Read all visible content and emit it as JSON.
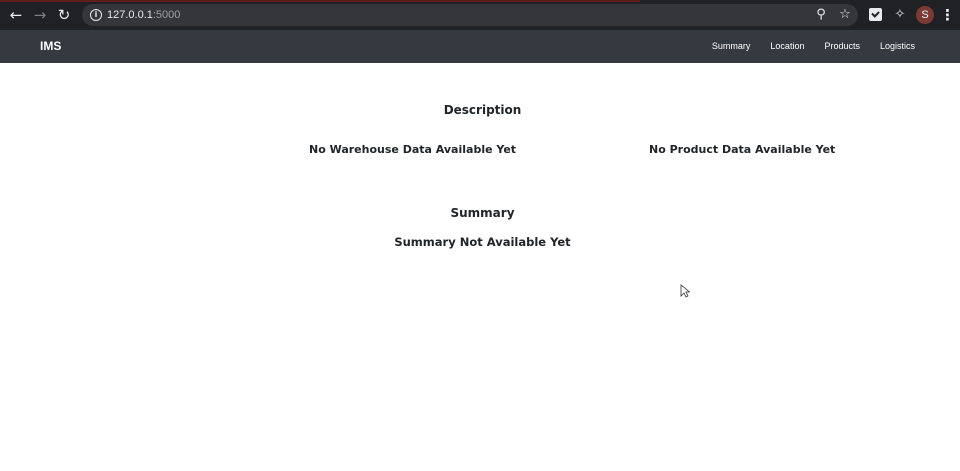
{
  "browser": {
    "url_host": "127.0.0.1",
    "url_port": ":5000",
    "profile_initial": "S"
  },
  "navbar": {
    "brand": "IMS",
    "links": [
      "Summary",
      "Location",
      "Products",
      "Logistics"
    ]
  },
  "main": {
    "description_title": "Description",
    "warehouse_message": "No Warehouse Data Available Yet",
    "product_message": "No Product Data Available Yet",
    "summary_title": "Summary",
    "summary_message": "Summary Not Available Yet"
  }
}
